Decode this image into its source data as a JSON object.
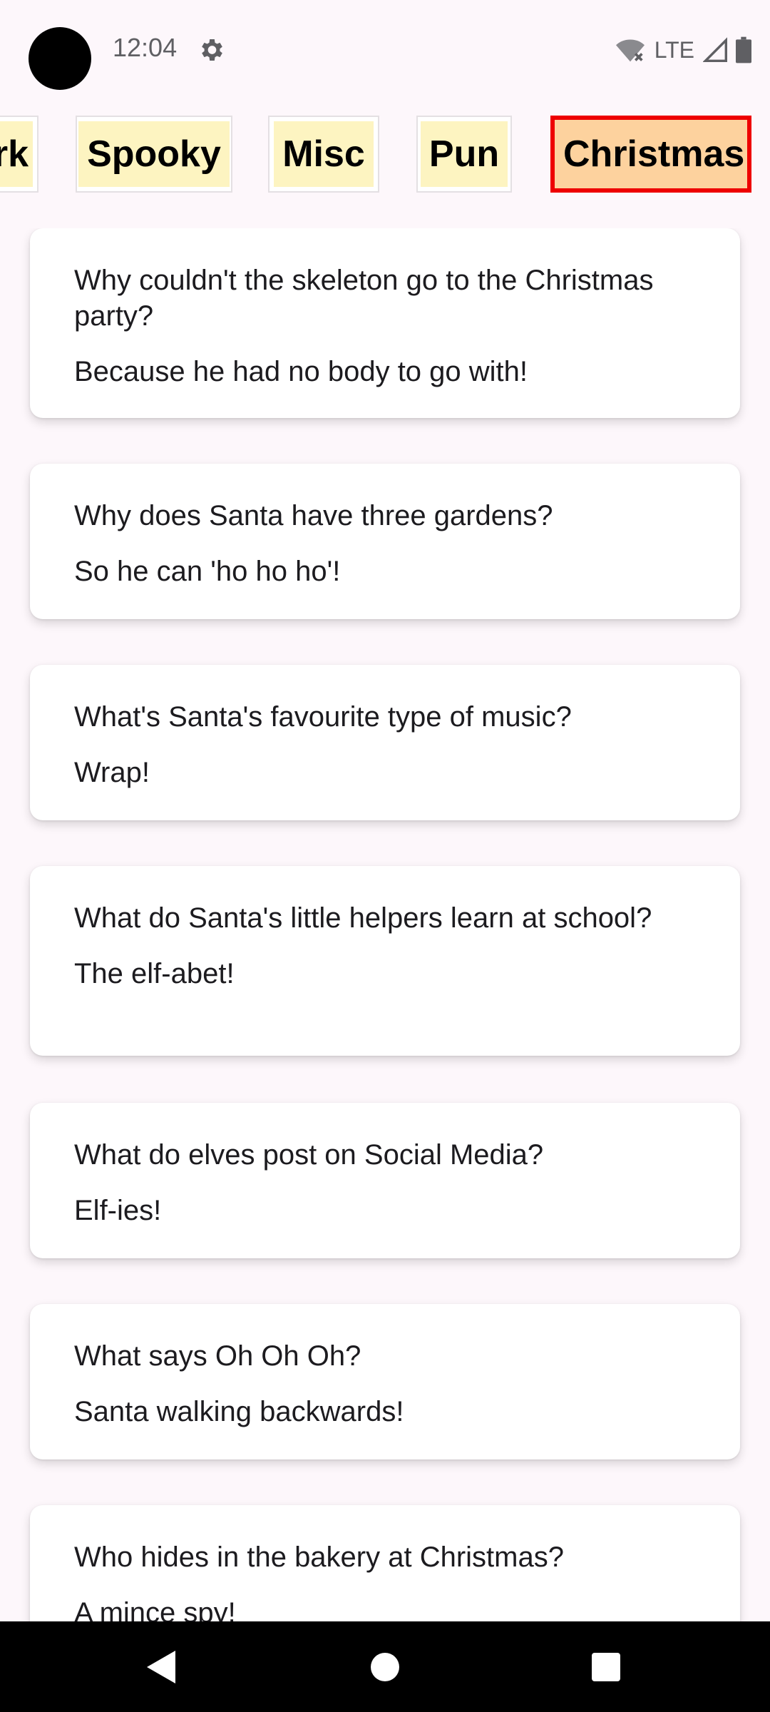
{
  "status_bar": {
    "time": "12:04",
    "network_label": "LTE",
    "icons": [
      "settings-icon",
      "wifi-off-icon",
      "signal-icon",
      "battery-icon"
    ]
  },
  "categories": {
    "items": [
      "rk",
      "Spooky",
      "Misc",
      "Pun",
      "Christmas"
    ],
    "selected": "Christmas"
  },
  "jokes": [
    {
      "question": "Why couldn't the skeleton go to the Christmas party?",
      "answer": "Because he had no body to go with!"
    },
    {
      "question": "Why does Santa have three gardens?",
      "answer": "So he can 'ho ho ho'!"
    },
    {
      "question": "What's Santa's favourite type of music?",
      "answer": "Wrap!"
    },
    {
      "question": "What do Santa's little helpers learn at school?",
      "answer": "The elf-abet!"
    },
    {
      "question": "What do elves post on Social Media?",
      "answer": "Elf-ies!"
    },
    {
      "question": "What says Oh Oh Oh?",
      "answer": "Santa walking backwards!"
    },
    {
      "question": "Who hides in the bakery at Christmas?",
      "answer": "A mince spy!"
    }
  ],
  "colors": {
    "background": "#fdf7fb",
    "chip_fill": "#fdf4c1",
    "chip_selected_fill": "#fdd29e",
    "chip_selected_border": "#ee0000"
  },
  "nav": {
    "icons": [
      "back-icon",
      "home-icon",
      "recents-icon"
    ]
  }
}
